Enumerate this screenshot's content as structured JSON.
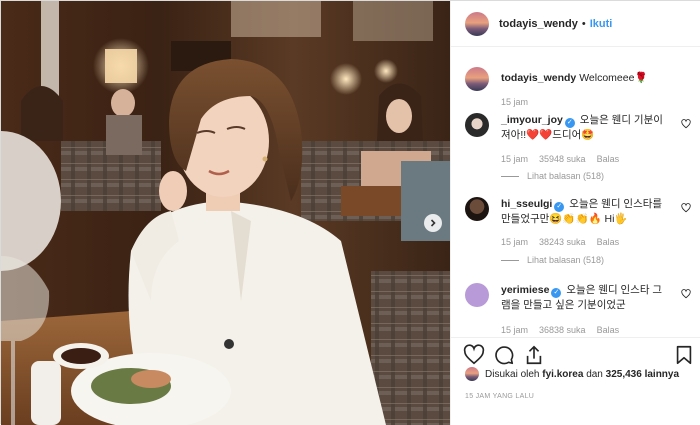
{
  "post": {
    "username": "todayis_wendy",
    "separator": "•",
    "follow_label": "Ikuti",
    "caption": {
      "username": "todayis_wendy",
      "text": "Welcomeee🌹",
      "time": "15 jam"
    },
    "comments": [
      {
        "username": "_imyour_joy",
        "verified": "✓",
        "text": "오늘은 웬디 기분이 져아!!❤️❤️드디어🤩",
        "time": "15 jam",
        "likes": "35948 suka",
        "reply_label": "Balas",
        "view_replies": "Lihat balasan (518)"
      },
      {
        "username": "hi_sseulgi",
        "verified": "✓",
        "text": "오늘은 웬디 인스타를 만들었구만😆👏👏🔥 Hi🖐",
        "time": "15 jam",
        "likes": "38243 suka",
        "reply_label": "Balas",
        "view_replies": "Lihat balasan (518)"
      },
      {
        "username": "yerimiese",
        "verified": "✓",
        "text": "오늘은 웬디 인스타 그램을 만들고 싶은 기분이었군",
        "time": "15 jam",
        "likes": "36838 suka",
        "reply_label": "Balas"
      }
    ],
    "liked_by": {
      "prefix": "Disukai oleh",
      "user": "fyi.korea",
      "conjunction": "dan",
      "others": "325,436 lainnya"
    },
    "time_ago": "15 JAM YANG LALU"
  },
  "icons": {
    "like": "heart-icon",
    "comment": "comment-bubble-icon",
    "share": "share-arrow-icon",
    "save": "bookmark-icon",
    "next": "chevron-right-icon"
  },
  "colors": {
    "accent": "#3897f0",
    "muted": "#999999",
    "heart": "#ed4956"
  }
}
